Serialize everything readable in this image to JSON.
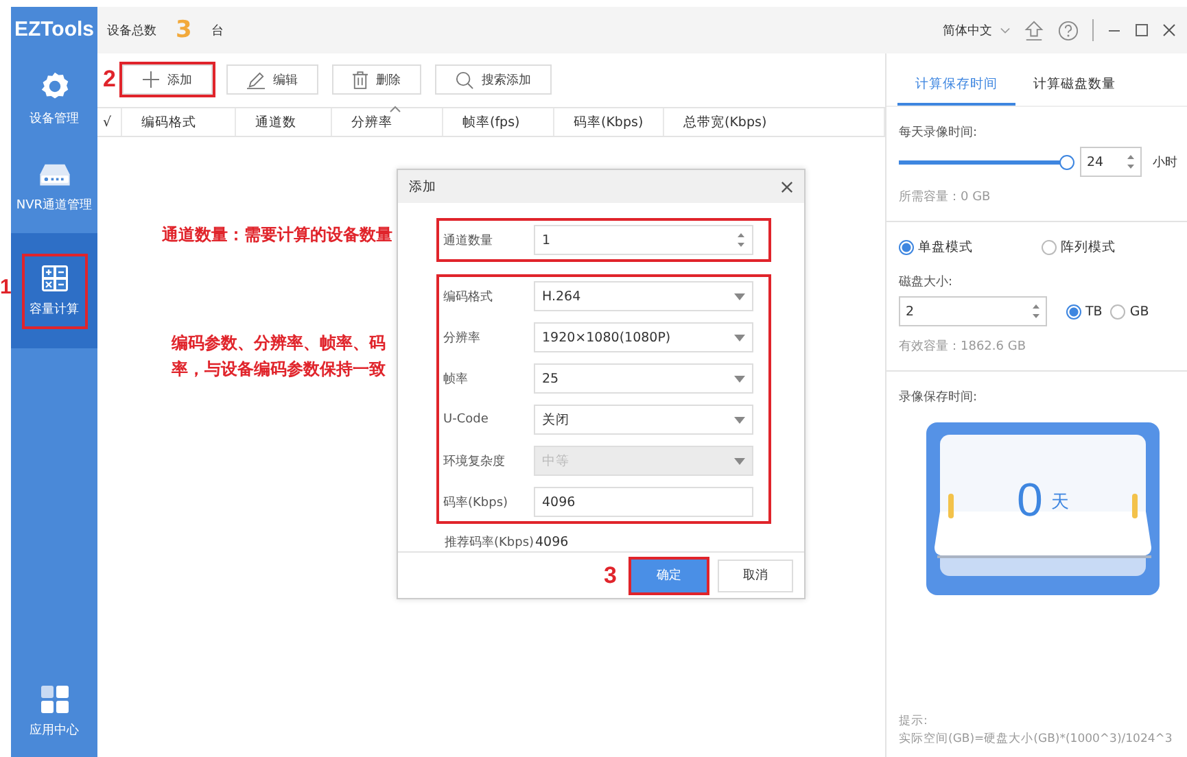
{
  "app": {
    "logo": "EZTools"
  },
  "sidebar": {
    "items": [
      {
        "label": "设备管理",
        "kind": "gear",
        "selected": false,
        "highlighted": false
      },
      {
        "label": "NVR通道管理",
        "kind": "nvr",
        "selected": false,
        "highlighted": false
      },
      {
        "label": "容量计算",
        "kind": "calculator",
        "selected": true,
        "highlighted": true,
        "marker": "1"
      }
    ],
    "footer_item": {
      "label": "应用中心",
      "kind": "apps",
      "selected": false
    }
  },
  "header": {
    "total_label": "设备总数",
    "total": "3",
    "unit": "台",
    "language": "简体中文"
  },
  "toolbar": [
    {
      "label": "添加",
      "kind": "add",
      "highlighted": true,
      "marker": "2"
    },
    {
      "label": "编辑",
      "kind": "edit",
      "highlighted": false
    },
    {
      "label": "删除",
      "kind": "delete",
      "highlighted": false
    },
    {
      "label": "搜索添加",
      "kind": "search",
      "highlighted": false
    }
  ],
  "table": {
    "columns": [
      {
        "label": "√",
        "sorted": false
      },
      {
        "label": "编码格式",
        "sorted": false
      },
      {
        "label": "通道数",
        "sorted": false
      },
      {
        "label": "分辨率",
        "sorted": true
      },
      {
        "label": "帧率(fps)",
        "sorted": false
      },
      {
        "label": "码率(Kbps)",
        "sorted": false
      },
      {
        "label": "总带宽(Kbps)",
        "sorted": false
      }
    ]
  },
  "right_panel": {
    "tabs": [
      {
        "label": "计算保存时间",
        "selected": true
      },
      {
        "label": "计算磁盘数量",
        "selected": false
      }
    ],
    "daily_label": "每天录像时间:",
    "daily_slider": {
      "level": 1
    },
    "hours": "24",
    "hours_unit": "小时",
    "required": "所需容量：0 GB",
    "modes": [
      {
        "label": "单盘模式",
        "selected": true
      },
      {
        "label": "阵列模式",
        "selected": false
      }
    ],
    "disk_size_label": "磁盘大小:",
    "disk_size": "2",
    "units": [
      {
        "label": "TB",
        "selected": true
      },
      {
        "label": "GB",
        "selected": false
      }
    ],
    "effective": "有效容量：1862.6 GB",
    "retention_label": "录像保存时间:",
    "days": "0",
    "days_unit": "天",
    "hint_title": "提示:",
    "hint": "实际空间(GB)=硬盘大小(GB)*(1000^3)/1024^3"
  },
  "dialog": {
    "title": "添加",
    "field_groups": [
      {
        "highlighted": true,
        "fields": [
          {
            "label": "通道数量",
            "value": "1",
            "kind": "spin"
          }
        ]
      },
      {
        "highlighted": true,
        "fields": [
          {
            "label": "编码格式",
            "value": "H.264",
            "kind": "select"
          },
          {
            "label": "分辨率",
            "value": "1920×1080(1080P)",
            "kind": "select"
          },
          {
            "label": "帧率",
            "value": "25",
            "kind": "select"
          },
          {
            "label": "U-Code",
            "value": "关闭",
            "kind": "select"
          },
          {
            "label": "环境复杂度",
            "value": "中等",
            "kind": "select",
            "disabled": true
          },
          {
            "label": "码率(Kbps)",
            "value": "4096",
            "kind": "text"
          }
        ]
      }
    ],
    "recommended": {
      "label": "推荐码率(Kbps)",
      "value": "4096"
    },
    "buttons": [
      {
        "label": "确定",
        "primary": true,
        "highlighted": true,
        "marker": "3"
      },
      {
        "label": "取消",
        "primary": false,
        "highlighted": false
      }
    ]
  },
  "annotations": [
    "通道数量：需要计算的设备数量",
    "编码参数、分辨率、帧率、码率，与设备编码参数保持一致"
  ]
}
